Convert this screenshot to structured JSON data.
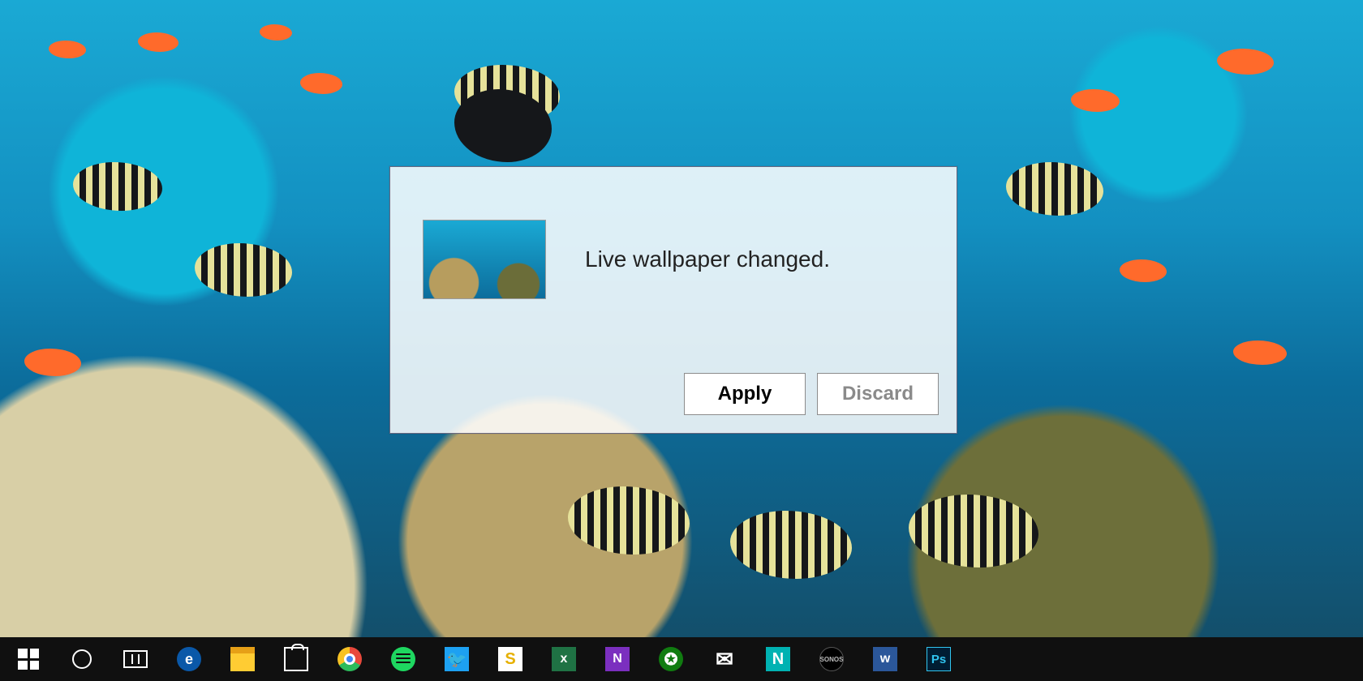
{
  "dialog": {
    "message": "Live wallpaper changed.",
    "apply_label": "Apply",
    "discard_label": "Discard"
  },
  "taskbar": {
    "items": [
      {
        "name": "start",
        "glyph": ""
      },
      {
        "name": "cortana",
        "glyph": ""
      },
      {
        "name": "task-view",
        "glyph": ""
      },
      {
        "name": "edge",
        "glyph": "e"
      },
      {
        "name": "file-explorer",
        "glyph": ""
      },
      {
        "name": "store",
        "glyph": ""
      },
      {
        "name": "chrome",
        "glyph": ""
      },
      {
        "name": "spotify",
        "glyph": ""
      },
      {
        "name": "twitter",
        "glyph": "🐦"
      },
      {
        "name": "slack",
        "glyph": "S"
      },
      {
        "name": "excel",
        "glyph": "x"
      },
      {
        "name": "onenote",
        "glyph": "N"
      },
      {
        "name": "xbox",
        "glyph": "✪"
      },
      {
        "name": "mail",
        "glyph": "✉"
      },
      {
        "name": "nextgen",
        "glyph": "N"
      },
      {
        "name": "sonos",
        "glyph": "SONOS"
      },
      {
        "name": "word",
        "glyph": "w"
      },
      {
        "name": "photoshop",
        "glyph": "Ps"
      }
    ]
  }
}
